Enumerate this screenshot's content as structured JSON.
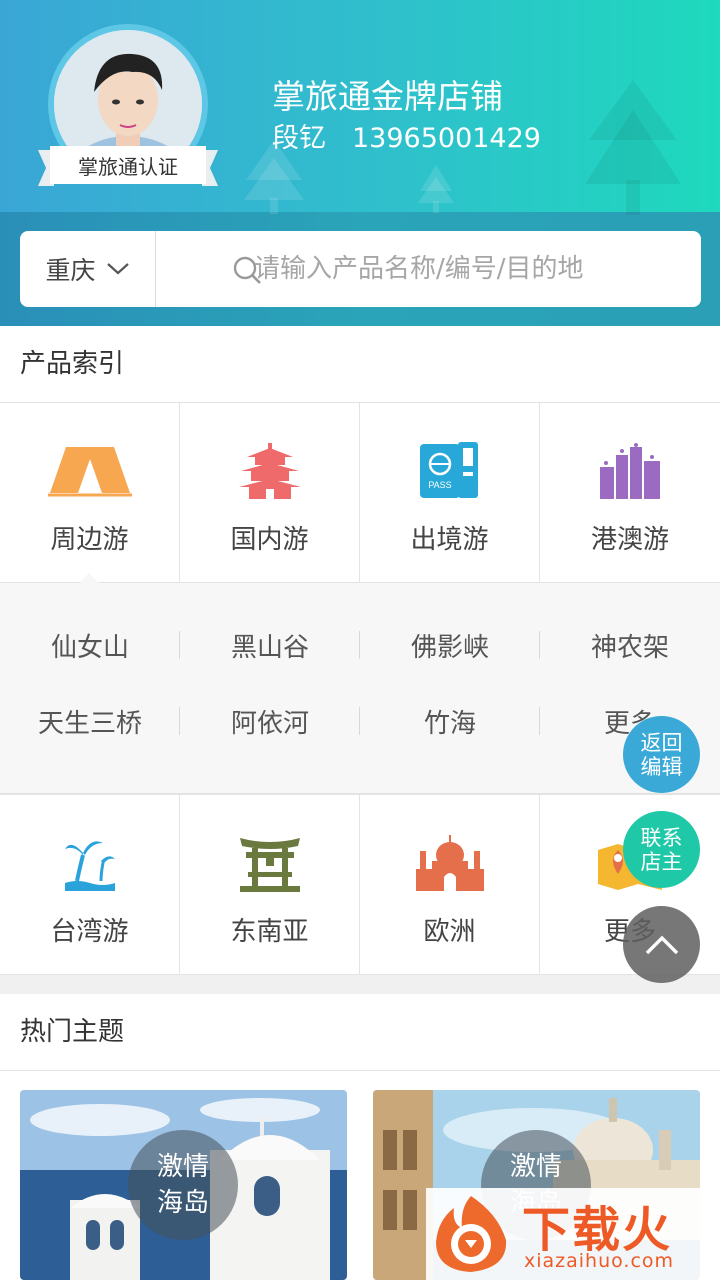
{
  "header": {
    "badge": "掌旅通认证",
    "shop_name": "掌旅通金牌店铺",
    "owner_name": "段钇",
    "owner_phone": "13965001429"
  },
  "search": {
    "city": "重庆",
    "placeholder": "请输入产品名称/编号/目的地"
  },
  "product_index": {
    "title": "产品索引",
    "row1": [
      {
        "label": "周边游",
        "icon": "tent-icon"
      },
      {
        "label": "国内游",
        "icon": "pagoda-icon"
      },
      {
        "label": "出境游",
        "icon": "passport-icon"
      },
      {
        "label": "港澳游",
        "icon": "city-icon"
      }
    ],
    "sub_destinations": [
      [
        "仙女山",
        "黑山谷",
        "佛影峡",
        "神农架"
      ],
      [
        "天生三桥",
        "阿依河",
        "竹海",
        "更多"
      ]
    ],
    "row2": [
      {
        "label": "台湾游",
        "icon": "palm-tree-icon"
      },
      {
        "label": "东南亚",
        "icon": "torii-icon"
      },
      {
        "label": "欧洲",
        "icon": "taj-mahal-icon"
      },
      {
        "label": "更多",
        "icon": "map-icon"
      }
    ]
  },
  "floating": {
    "back_edit": "返回\n编辑",
    "contact_owner": "联系\n店主"
  },
  "hot_themes": {
    "title": "热门主题",
    "cards": [
      {
        "label": "激情\n海岛"
      },
      {
        "label": "激情\n海岛"
      }
    ]
  },
  "watermark": {
    "brand": "下载火",
    "url": "xiazaihuo.com"
  },
  "colors": {
    "header_start": "#3aa6d6",
    "header_end": "#1ed9bd",
    "fab_blue": "#3aa9d8",
    "fab_green": "#1fc9a8"
  }
}
